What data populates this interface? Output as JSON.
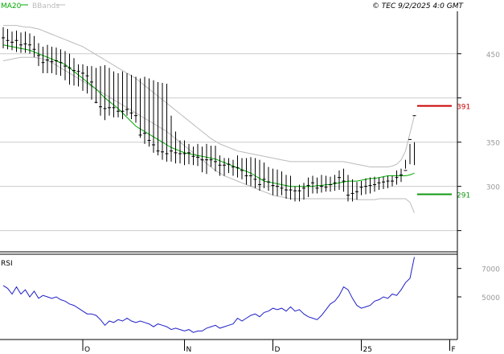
{
  "header": {
    "legend_ma": "MA20",
    "legend_bbands": "BBands",
    "info": "© TEC 9/2/2025 4:0 GMT"
  },
  "colors": {
    "ma": "#00aa00",
    "bbands": "#bbbbbb",
    "price": "#000000",
    "rsi": "#1f1fc8",
    "resistance": "#cc0000",
    "support": "#119911",
    "grid": "#cccccc",
    "axis_text": "#999999"
  },
  "labels": {
    "resistance": "391",
    "support": "291",
    "rsi_title": "RSI"
  },
  "chart_data": [
    {
      "type": "line",
      "title": "",
      "y_axis": {
        "ticks": [
          250,
          300,
          350,
          400,
          450
        ],
        "tick_labels": [
          "",
          "300",
          "350",
          "",
          "450"
        ],
        "ylim": [
          226,
          498
        ]
      },
      "x_axis": {
        "labels": [
          "O",
          "N",
          "D",
          "25",
          "F"
        ],
        "label_index": [
          18,
          41,
          61,
          81,
          101
        ]
      },
      "levels": [
        {
          "name": "resistance",
          "value": 391
        },
        {
          "name": "support",
          "value": 291
        }
      ],
      "series": [
        {
          "name": "price",
          "style": "bars",
          "high": [
            480,
            478,
            475,
            476,
            474,
            475,
            473,
            470,
            462,
            458,
            460,
            458,
            457,
            455,
            453,
            450,
            445,
            438,
            438,
            436,
            436,
            434,
            436,
            437,
            434,
            430,
            428,
            430,
            428,
            426,
            424,
            422,
            424,
            422,
            420,
            418,
            417,
            416,
            380,
            362,
            352,
            352,
            348,
            345,
            348,
            345,
            348,
            346,
            346,
            335,
            332,
            332,
            330,
            335,
            332,
            332,
            333,
            332,
            330,
            327,
            322,
            320,
            319,
            317,
            313,
            312,
            300,
            302,
            304,
            310,
            312,
            310,
            313,
            312,
            311,
            313,
            318,
            320,
            313,
            308,
            305,
            306,
            309,
            310,
            311,
            310,
            311,
            312,
            312,
            318,
            320,
            330,
            325,
            324
          ],
          "low": [
            456,
            455,
            454,
            452,
            451,
            451,
            450,
            446,
            436,
            428,
            428,
            428,
            426,
            425,
            420,
            415,
            414,
            413,
            408,
            405,
            398,
            394,
            380,
            375,
            380,
            378,
            378,
            376,
            380,
            376,
            372,
            355,
            348,
            345,
            338,
            335,
            330,
            328,
            328,
            326,
            326,
            324,
            325,
            324,
            323,
            316,
            314,
            322,
            317,
            312,
            312,
            315,
            312,
            310,
            308,
            302,
            300,
            298,
            295,
            298,
            295,
            290,
            289,
            290,
            286,
            285,
            283,
            283,
            285,
            288,
            292,
            292,
            293,
            294,
            294,
            295,
            296,
            294,
            283,
            283,
            285,
            290,
            291,
            292,
            294,
            296,
            297,
            298,
            300,
            302,
            305,
            320,
            348,
            350
          ],
          "close": [
            468,
            465,
            463,
            465,
            460,
            461,
            460,
            455,
            448,
            440,
            443,
            441,
            442,
            440,
            436,
            434,
            431,
            430,
            428,
            425,
            418,
            395,
            390,
            388,
            389,
            389,
            385,
            385,
            387,
            383,
            380,
            358,
            360,
            352,
            347,
            340,
            339,
            337,
            340,
            338,
            337,
            337,
            338,
            334,
            333,
            330,
            330,
            330,
            328,
            324,
            324,
            325,
            322,
            321,
            318,
            312,
            312,
            308,
            302,
            308,
            305,
            301,
            300,
            298,
            296,
            296,
            295,
            295,
            298,
            301,
            304,
            298,
            300,
            299,
            302,
            304,
            310,
            306,
            290,
            292,
            294,
            299,
            300,
            301,
            302,
            304,
            305,
            306,
            306,
            310,
            313,
            318,
            353,
            380
          ]
        },
        {
          "name": "MA20",
          "values": [
            460,
            459,
            458,
            457,
            456,
            455,
            454,
            452,
            450,
            448,
            446,
            444,
            442,
            440,
            438,
            434,
            430,
            426,
            422,
            418,
            414,
            410,
            405,
            400,
            396,
            392,
            388,
            383,
            378,
            373,
            368,
            365,
            362,
            359,
            356,
            353,
            350,
            347,
            344,
            342,
            340,
            338,
            337,
            336,
            335,
            334,
            333,
            332,
            331,
            329,
            327,
            325,
            323,
            321,
            319,
            317,
            315,
            312,
            309,
            306,
            305,
            304,
            303,
            302,
            301,
            300,
            300,
            300,
            300,
            300,
            300,
            301,
            301,
            302,
            302,
            303,
            304,
            305,
            306,
            306,
            306,
            307,
            308,
            309,
            309,
            310,
            311,
            312,
            312,
            312,
            312,
            312,
            313,
            315
          ]
        },
        {
          "name": "BBands upper",
          "values": [
            482,
            482,
            482,
            482,
            481,
            480,
            480,
            479,
            478,
            476,
            474,
            472,
            470,
            468,
            466,
            464,
            462,
            460,
            458,
            455,
            452,
            449,
            446,
            443,
            440,
            437,
            434,
            431,
            428,
            425,
            422,
            418,
            414,
            410,
            406,
            402,
            398,
            394,
            390,
            386,
            382,
            378,
            374,
            370,
            366,
            362,
            358,
            354,
            351,
            348,
            346,
            344,
            342,
            340,
            339,
            338,
            337,
            336,
            335,
            334,
            333,
            332,
            331,
            330,
            329,
            328,
            328,
            328,
            328,
            328,
            328,
            328,
            328,
            328,
            328,
            328,
            328,
            328,
            327,
            326,
            325,
            324,
            323,
            322,
            322,
            322,
            322,
            322,
            323,
            325,
            330,
            340,
            360,
            380
          ]
        },
        {
          "name": "BBands lower",
          "values": [
            442,
            443,
            444,
            445,
            446,
            446,
            446,
            446,
            445,
            444,
            442,
            440,
            437,
            434,
            431,
            428,
            425,
            422,
            419,
            416,
            413,
            410,
            407,
            404,
            401,
            398,
            395,
            392,
            389,
            386,
            383,
            380,
            377,
            374,
            371,
            368,
            365,
            362,
            358,
            354,
            350,
            346,
            342,
            338,
            334,
            330,
            326,
            322,
            318,
            315,
            312,
            310,
            308,
            306,
            304,
            302,
            300,
            298,
            296,
            294,
            292,
            290,
            289,
            288,
            287,
            286,
            286,
            286,
            286,
            286,
            286,
            286,
            286,
            286,
            286,
            286,
            286,
            286,
            286,
            286,
            285,
            285,
            285,
            285,
            285,
            286,
            286,
            286,
            286,
            286,
            286,
            286,
            282,
            270
          ]
        }
      ]
    },
    {
      "type": "line",
      "title": "RSI",
      "y_axis": {
        "ticks": [
          50,
          70
        ],
        "tick_labels": [
          "5000",
          "7000"
        ],
        "ylim": [
          20,
          80
        ]
      },
      "series": [
        {
          "name": "RSI",
          "values": [
            58,
            56,
            52,
            57,
            52,
            55,
            50,
            54,
            49,
            51,
            50,
            49,
            50,
            48,
            47,
            45,
            44,
            42,
            40,
            38,
            38,
            37,
            34,
            30,
            33,
            32,
            34,
            33,
            35,
            33,
            32,
            33,
            32,
            31,
            29,
            31,
            30,
            29,
            27,
            28,
            27,
            26,
            27,
            25,
            26,
            26,
            28,
            29,
            30,
            28,
            29,
            30,
            31,
            35,
            33,
            35,
            37,
            38,
            36,
            39,
            40,
            42,
            41,
            42,
            40,
            43,
            40,
            41,
            38,
            36,
            35,
            34,
            37,
            41,
            45,
            47,
            51,
            57,
            55,
            49,
            44,
            42,
            43,
            44,
            47,
            48,
            50,
            49,
            52,
            51,
            55,
            60,
            63,
            78
          ]
        }
      ]
    }
  ]
}
